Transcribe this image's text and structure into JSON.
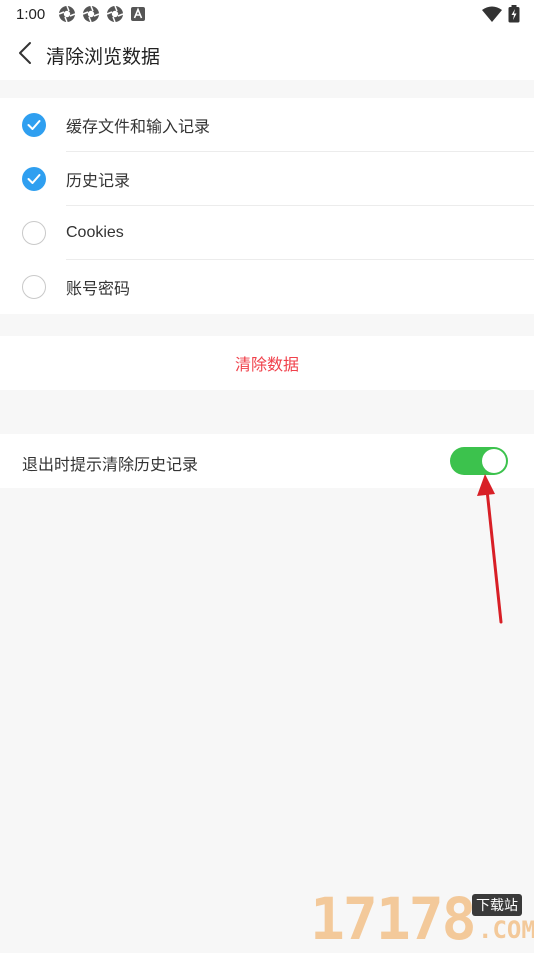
{
  "status_bar": {
    "time": "1:00",
    "left_icons": [
      "aperture-icon",
      "aperture-icon",
      "aperture-icon",
      "a-icon"
    ],
    "right_icons": [
      "wifi-icon",
      "battery-icon"
    ]
  },
  "header": {
    "back_icon": "chevron-left-icon",
    "title": "清除浏览数据"
  },
  "options": [
    {
      "label": "缓存文件和输入记录",
      "checked": true
    },
    {
      "label": "历史记录",
      "checked": true
    },
    {
      "label": "Cookies",
      "checked": false
    },
    {
      "label": "账号密码",
      "checked": false
    }
  ],
  "clear_button": {
    "label": "清除数据",
    "color": "#f0414b"
  },
  "exit_prompt": {
    "label": "退出时提示清除历史记录",
    "enabled": true,
    "switch_color": "#3cc24d"
  },
  "colors": {
    "check_on": "#2f9ff0",
    "background": "#f7f7f7"
  },
  "watermark": {
    "digits": "17178",
    "tag": "下载站",
    "suffix": ".COM"
  }
}
